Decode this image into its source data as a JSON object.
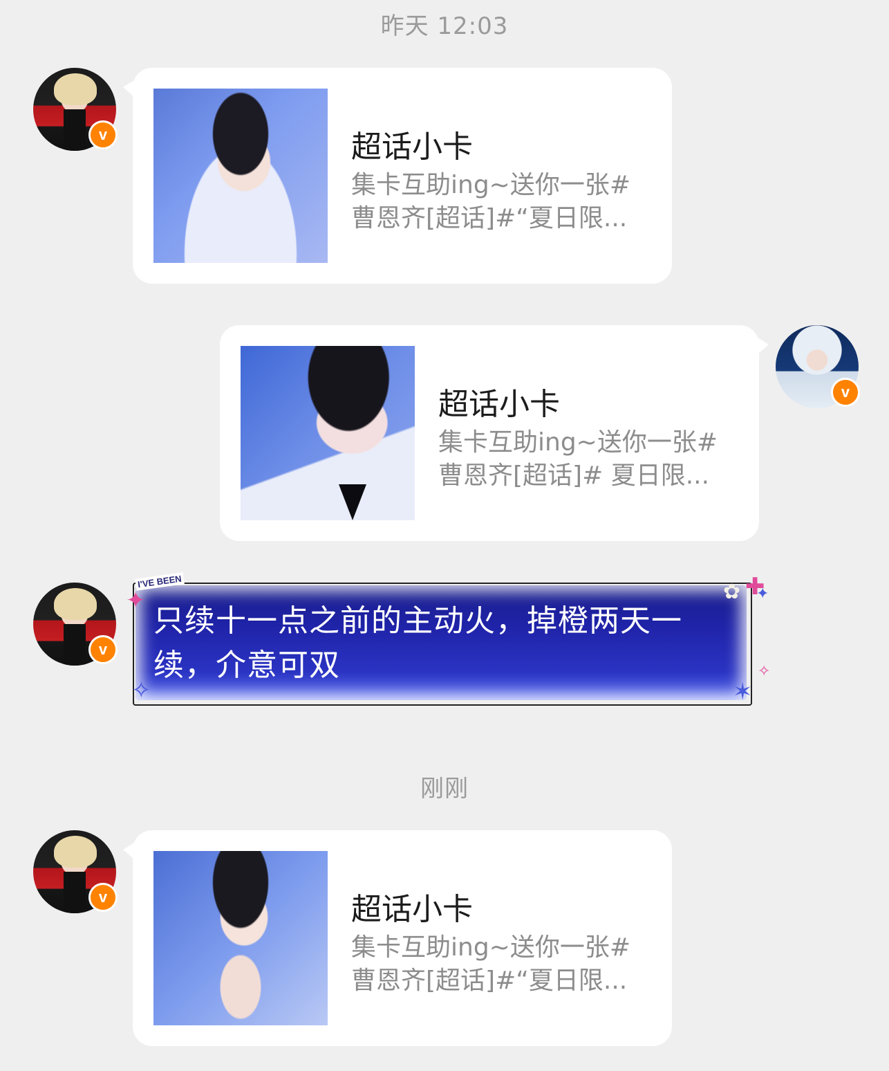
{
  "timestamps": [
    "昨天 12:03",
    "刚刚"
  ],
  "messages": [
    {
      "type": "card",
      "side": "left",
      "title": "超话小卡",
      "desc_line1": "集卡互助ing~送你一张#",
      "desc_line2": "曹恩齐[超话]#“夏日限..."
    },
    {
      "type": "card",
      "side": "right",
      "title": "超话小卡",
      "desc_line1": "集卡互助ing~送你一张#",
      "desc_line2": "曹恩齐[超话]# 夏日限..."
    },
    {
      "type": "text",
      "side": "left",
      "bubble_tag": "I'VE BEEN",
      "text": "只续十一点之前的主动火，掉橙两天一续，介意可双"
    },
    {
      "type": "card",
      "side": "left",
      "title": "超话小卡",
      "desc_line1": "集卡互助ing~送你一张#",
      "desc_line2": "曹恩齐[超话]#“夏日限..."
    }
  ],
  "badges": {
    "verified_label": "v",
    "color": "#ff8200"
  },
  "colors": {
    "background": "#efefef",
    "bubble": "#ffffff",
    "fancy_bubble": "#1f23a8"
  }
}
